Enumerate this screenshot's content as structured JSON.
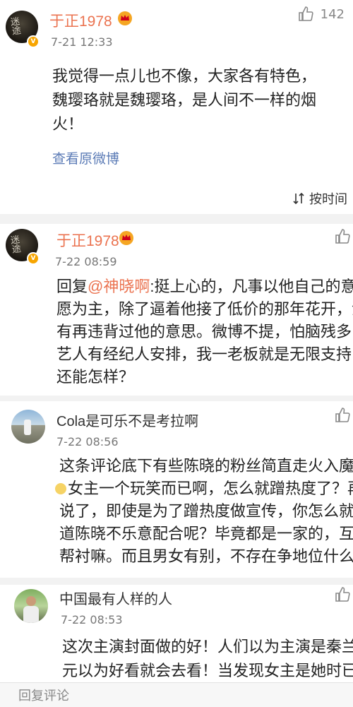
{
  "comments": [
    {
      "author": "于正1978",
      "time": "7-21 12:33",
      "likes": "142",
      "lines": [
        "我觉得一点儿也不像，大家各有特色，",
        "魏璎珞就是魏璎珞，是人间不一样的烟",
        "火！"
      ],
      "view_original": "查看原微博"
    },
    {
      "author": "于正1978",
      "time": "7-22 08:59",
      "reply_prefix": "回复",
      "mention": "@神晓啊",
      "lines": [
        ":挺上心的，凡事以他自己的意",
        "愿为主，除了逼着他接了低价的那年花开，没",
        "有再违背过他的意思。微博不提，怕脑残多，",
        "艺人有经纪人安排，我一老板就是无限支持，",
        "还能怎样？"
      ]
    },
    {
      "author": "Cola是可乐不是考拉啊",
      "time": "7-22 08:56",
      "lines": [
        "这条评论底下有些陈晓的粉丝简直走火入魔了",
        "女主一个玩笑而已啊，怎么就蹭热度了？再",
        "说了，即使是为了蹭热度做宣传，你怎么就知",
        "道陈晓不乐意配合呢？毕竟都是一家的，互相",
        "帮衬嘛。而且男女有别，不存在争地位什么的"
      ]
    },
    {
      "author": "中国最有人样的人",
      "time": "7-22 08:53",
      "lines": [
        "这次主演封面做的好！人们以为主演是秦兰聂",
        "元以为好看就会去看！当发现女主是她时已经"
      ]
    }
  ],
  "sort_label": "按时间",
  "input_placeholder": "回复评论",
  "colors": {
    "accent": "#eb7350",
    "link": "#5b7bb6",
    "badge": "#f7a500"
  },
  "icons": {
    "like": "thumbs-up-icon",
    "verified": "verified-badge-icon",
    "crown": "vip-crown-icon",
    "sort": "sort-icon",
    "emoji": "emoji-icon"
  }
}
